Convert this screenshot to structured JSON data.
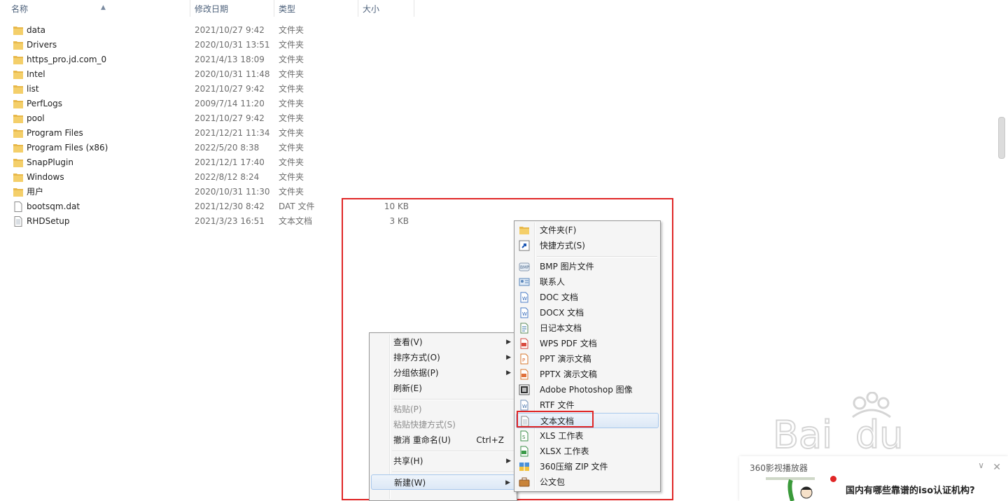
{
  "columns": {
    "name": "名称",
    "modified": "修改日期",
    "type": "类型",
    "size": "大小"
  },
  "files": [
    {
      "name": "data",
      "date": "2021/10/27 9:42",
      "type": "文件夹",
      "size": "",
      "icon": "folder-icon"
    },
    {
      "name": "Drivers",
      "date": "2020/10/31 13:51",
      "type": "文件夹",
      "size": "",
      "icon": "folder-icon"
    },
    {
      "name": "https_pro.jd.com_0",
      "date": "2021/4/13 18:09",
      "type": "文件夹",
      "size": "",
      "icon": "folder-icon"
    },
    {
      "name": "Intel",
      "date": "2020/10/31 11:48",
      "type": "文件夹",
      "size": "",
      "icon": "folder-icon"
    },
    {
      "name": "list",
      "date": "2021/10/27 9:42",
      "type": "文件夹",
      "size": "",
      "icon": "folder-icon"
    },
    {
      "name": "PerfLogs",
      "date": "2009/7/14 11:20",
      "type": "文件夹",
      "size": "",
      "icon": "folder-icon"
    },
    {
      "name": "pool",
      "date": "2021/10/27 9:42",
      "type": "文件夹",
      "size": "",
      "icon": "folder-icon"
    },
    {
      "name": "Program Files",
      "date": "2021/12/21 11:34",
      "type": "文件夹",
      "size": "",
      "icon": "folder-icon"
    },
    {
      "name": "Program Files (x86)",
      "date": "2022/5/20 8:38",
      "type": "文件夹",
      "size": "",
      "icon": "folder-icon"
    },
    {
      "name": "SnapPlugin",
      "date": "2021/12/1 17:40",
      "type": "文件夹",
      "size": "",
      "icon": "folder-icon"
    },
    {
      "name": "Windows",
      "date": "2022/8/12 8:24",
      "type": "文件夹",
      "size": "",
      "icon": "folder-icon"
    },
    {
      "name": "用户",
      "date": "2020/10/31 11:30",
      "type": "文件夹",
      "size": "",
      "icon": "folder-icon"
    },
    {
      "name": "bootsqm.dat",
      "date": "2021/12/30 8:42",
      "type": "DAT 文件",
      "size": "10 KB",
      "icon": "file-icon"
    },
    {
      "name": "RHDSetup",
      "date": "2021/3/23 16:51",
      "type": "文本文档",
      "size": "3 KB",
      "icon": "text-file-icon"
    }
  ],
  "context_menu": {
    "view": "查看(V)",
    "sort": "排序方式(O)",
    "group": "分组依据(P)",
    "refresh": "刷新(E)",
    "paste": "粘贴(P)",
    "paste_shortcut": "粘贴快捷方式(S)",
    "undo_rename": "撤消 重命名(U)",
    "undo_shortcut": "Ctrl+Z",
    "share": "共享(H)",
    "new": "新建(W)"
  },
  "new_submenu": {
    "folder": "文件夹(F)",
    "shortcut": "快捷方式(S)",
    "bmp": "BMP 图片文件",
    "contact": "联系人",
    "doc": "DOC 文档",
    "docx": "DOCX 文档",
    "journal": "日记本文档",
    "wps_pdf": "WPS PDF 文档",
    "ppt": "PPT 演示文稿",
    "pptx": "PPTX 演示文稿",
    "psd": "Adobe Photoshop 图像",
    "rtf": "RTF 文件",
    "txt": "文本文档",
    "xls": "XLS 工作表",
    "xlsx": "XLSX 工作表",
    "zip": "360压缩 ZIP 文件",
    "briefcase": "公文包"
  },
  "ad": {
    "title": "360影视播放器",
    "question": "国内有哪些靠谱的iso认证机构?"
  },
  "colors": {
    "highlight_red": "#e02626",
    "menu_bg": "#f5f5f5",
    "header_text": "#4c607a"
  }
}
